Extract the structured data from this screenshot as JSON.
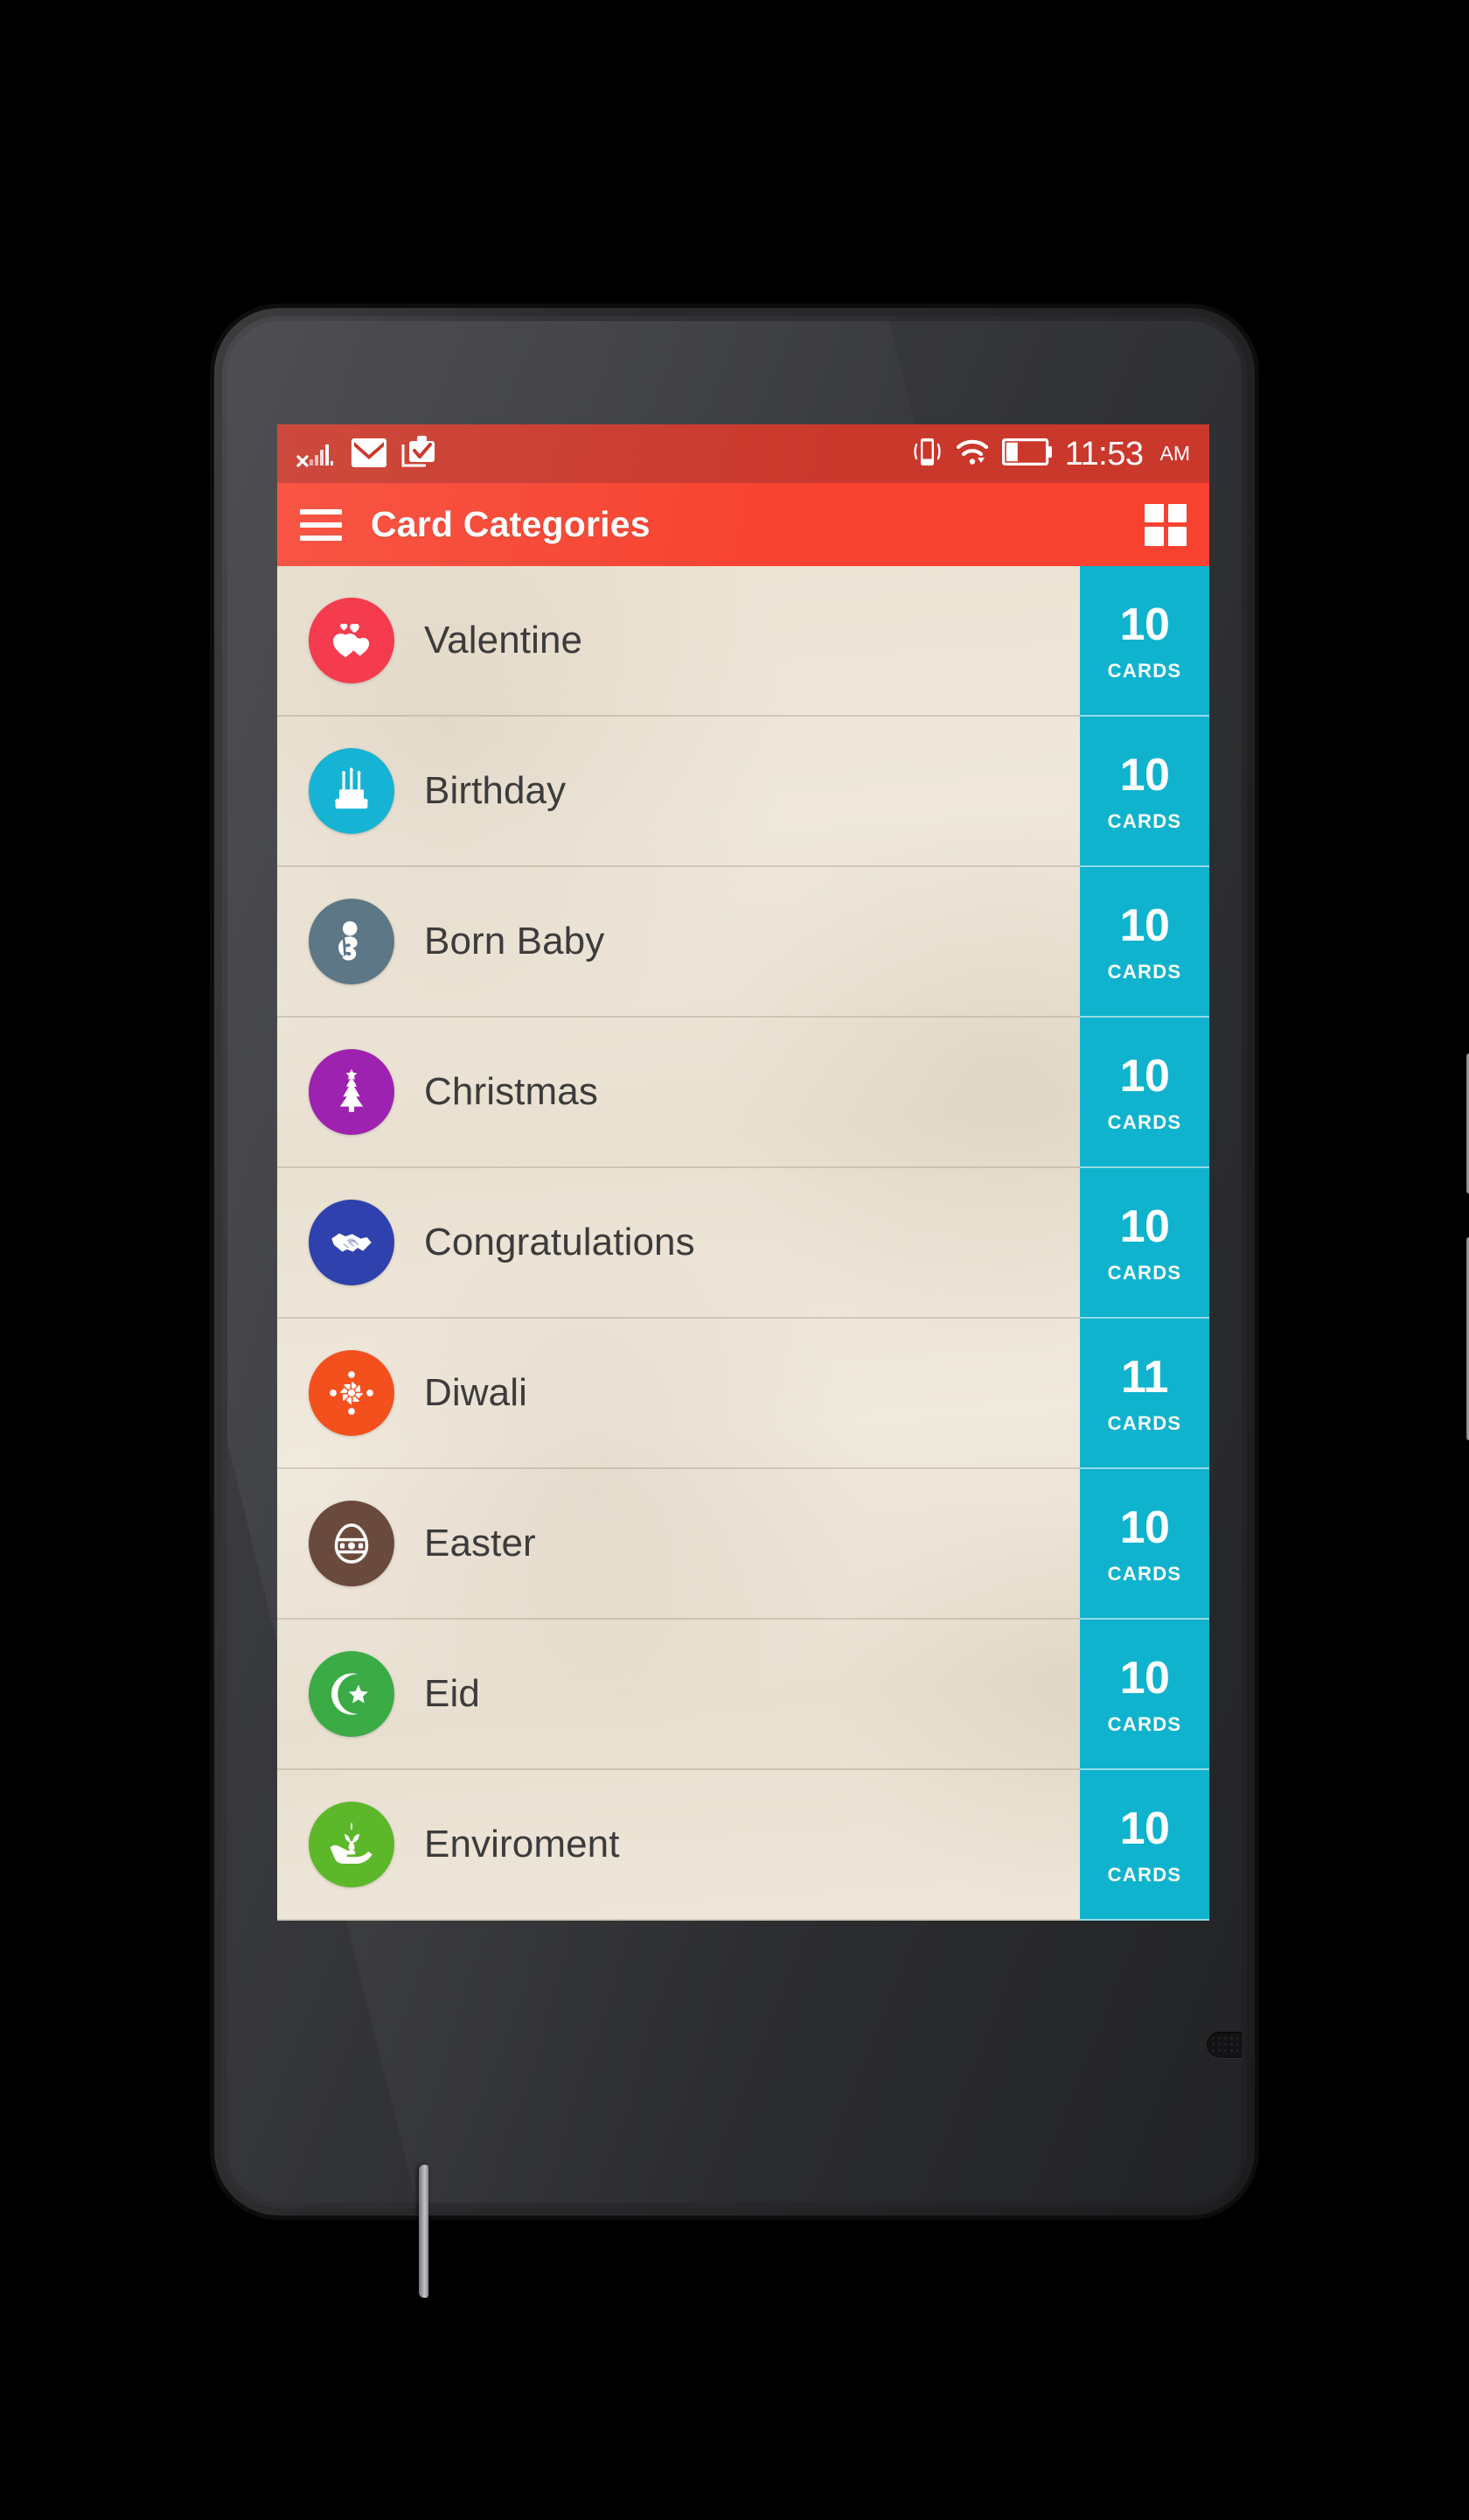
{
  "status_bar": {
    "time": "11:53",
    "ampm": "AM",
    "icons_left": [
      "no-sim-signal-icon",
      "gmail-icon",
      "clipboard-check-icon"
    ],
    "icons_right": [
      "vibrate-icon",
      "wifi-icon",
      "battery-icon"
    ],
    "background_color": "#c9382b"
  },
  "app_bar": {
    "title": "Card Categories",
    "menu_icon": "hamburger-menu-icon",
    "grid_icon": "grid-view-icon",
    "background_color": "#f7422f"
  },
  "list": {
    "badge_unit": "CARDS",
    "badge_color": "#10b3cd",
    "items": [
      {
        "label": "Valentine",
        "count": "10",
        "unit": "CARDS",
        "icon": "hearts-icon",
        "color": "#f53b4e"
      },
      {
        "label": "Birthday",
        "count": "10",
        "unit": "CARDS",
        "icon": "birthday-cake-icon",
        "color": "#16b3d4"
      },
      {
        "label": "Born Baby",
        "count": "10",
        "unit": "CARDS",
        "icon": "baby-icon",
        "color": "#5d7786"
      },
      {
        "label": "Christmas",
        "count": "10",
        "unit": "CARDS",
        "icon": "christmas-tree-icon",
        "color": "#9e22b0"
      },
      {
        "label": "Congratulations",
        "count": "10",
        "unit": "CARDS",
        "icon": "handshake-icon",
        "color": "#2f41ac"
      },
      {
        "label": "Diwali",
        "count": "11",
        "unit": "CARDS",
        "icon": "rangoli-icon",
        "color": "#f4501e"
      },
      {
        "label": "Easter",
        "count": "10",
        "unit": "CARDS",
        "icon": "easter-egg-icon",
        "color": "#6b4a3e"
      },
      {
        "label": "Eid",
        "count": "10",
        "unit": "CARDS",
        "icon": "crescent-star-icon",
        "color": "#3aab45"
      },
      {
        "label": "Enviroment",
        "count": "10",
        "unit": "CARDS",
        "icon": "hand-plant-icon",
        "color": "#5cb82a"
      }
    ]
  },
  "device": {
    "camera": "front-camera",
    "earpiece": "earpiece-speaker",
    "bottom_speaker": "bottom-speaker",
    "power_button": "power-button",
    "volume_button": "volume-rocker",
    "left_button": "left-side-button"
  }
}
